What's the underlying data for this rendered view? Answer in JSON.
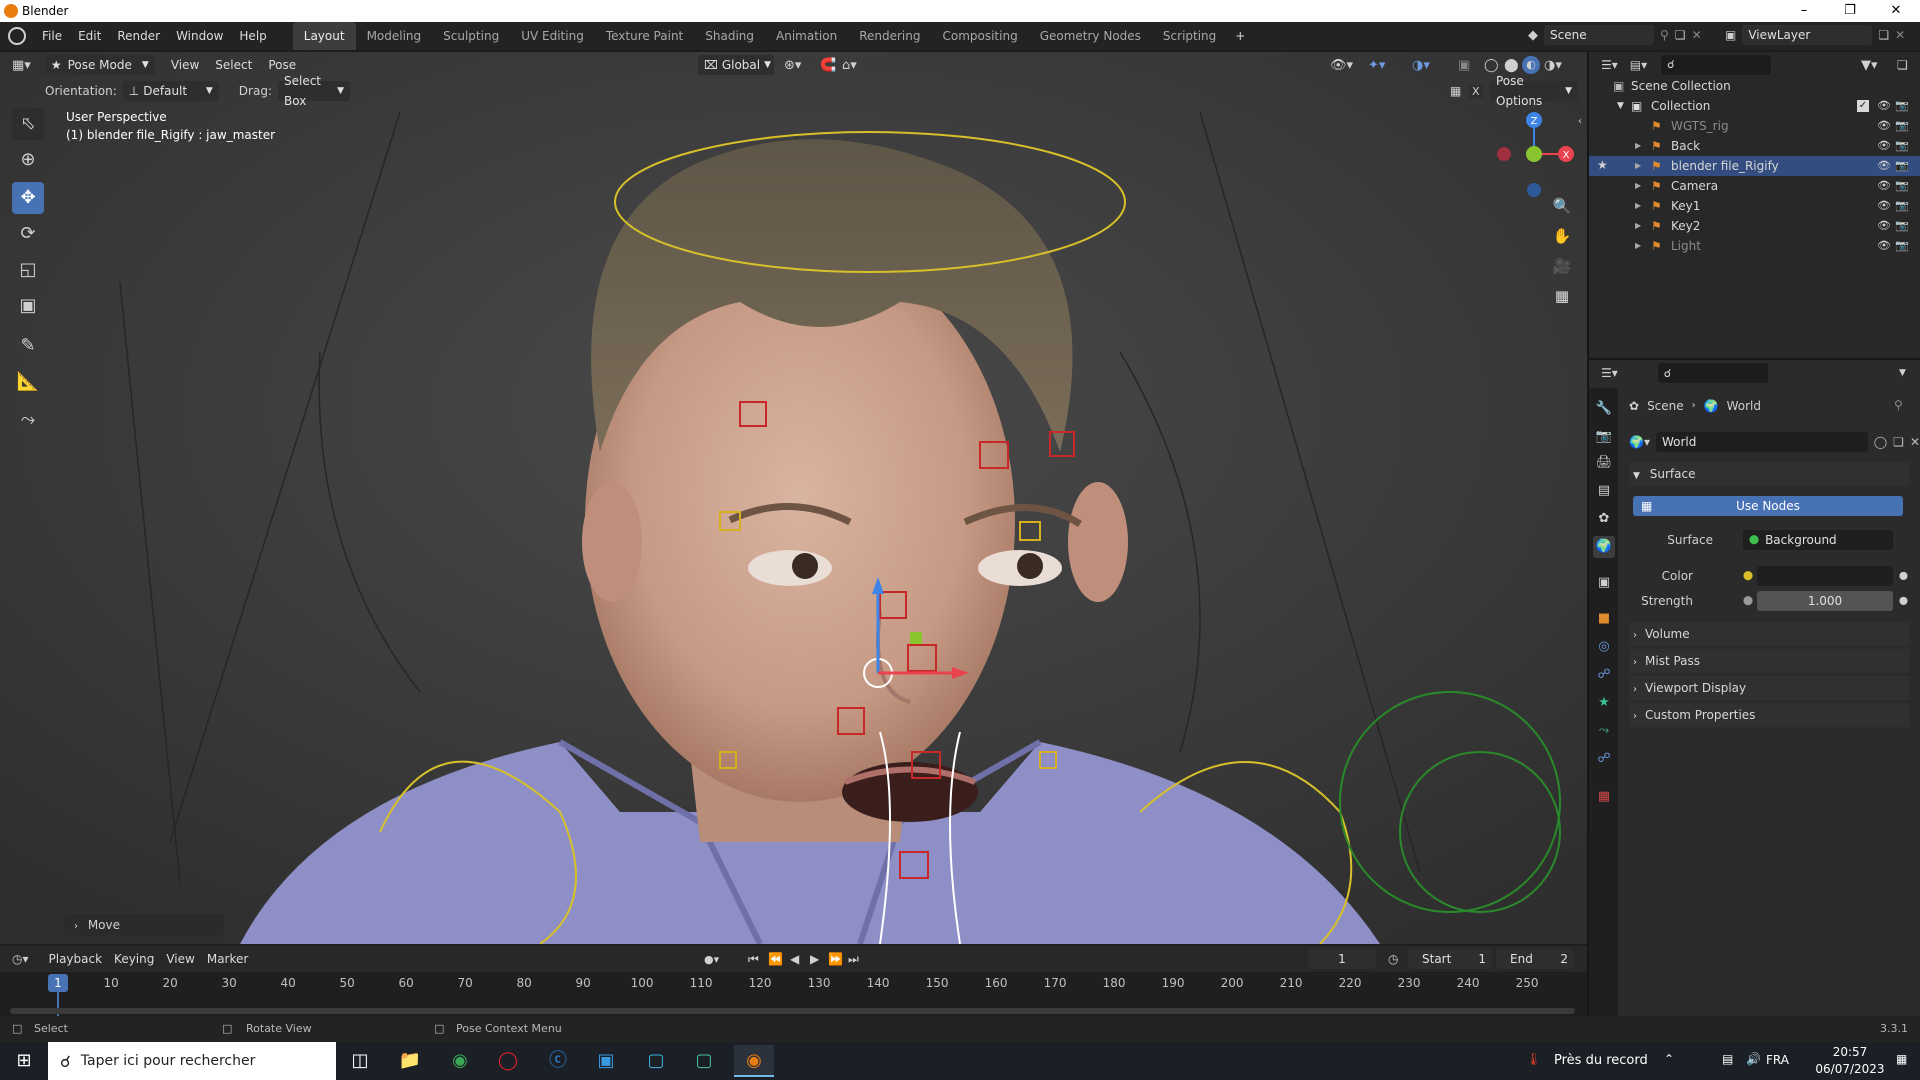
{
  "window": {
    "title": "Blender"
  },
  "menus": [
    "File",
    "Edit",
    "Render",
    "Window",
    "Help"
  ],
  "workspaces": [
    "Layout",
    "Modeling",
    "Sculpting",
    "UV Editing",
    "Texture Paint",
    "Shading",
    "Animation",
    "Rendering",
    "Compositing",
    "Geometry Nodes",
    "Scripting"
  ],
  "workspace_add": "+",
  "scene": {
    "name": "Scene",
    "view_layer": "ViewLayer"
  },
  "viewport": {
    "mode": "Pose Mode",
    "header_menus": [
      "View",
      "Select",
      "Pose"
    ],
    "transform_orientation": "Global",
    "orientation_label": "Orientation:",
    "orientation_value": "Default",
    "drag_label": "Drag:",
    "drag_value": "Select Box",
    "pose_options": "Pose Options",
    "overlay_title": "User Perspective",
    "overlay_object": "(1) blender file_Rigify : jaw_master",
    "last_op": "Move",
    "gizmo_labels": {
      "z": "Z",
      "x": "X"
    }
  },
  "outliner": {
    "root": "Scene Collection",
    "collection": "Collection",
    "items": [
      {
        "name": "WGTS_rig",
        "dim": true
      },
      {
        "name": "Back",
        "dim": false
      },
      {
        "name": "blender file_Rigify",
        "dim": false,
        "selected": true
      },
      {
        "name": "Camera",
        "dim": false
      },
      {
        "name": "Key1",
        "dim": false
      },
      {
        "name": "Key2",
        "dim": false
      },
      {
        "name": "Light",
        "dim": true
      }
    ]
  },
  "properties": {
    "breadcrumb": [
      "Scene",
      "World"
    ],
    "datablock": "World",
    "surface_panel": "Surface",
    "use_nodes": "Use Nodes",
    "surface_label": "Surface",
    "surface_value": "Background",
    "color_label": "Color",
    "strength_label": "Strength",
    "strength_value": "1.000",
    "panels": [
      "Volume",
      "Mist Pass",
      "Viewport Display",
      "Custom Properties"
    ]
  },
  "timeline": {
    "menus": [
      "Playback",
      "Keying",
      "View",
      "Marker"
    ],
    "current_frame": "1",
    "start_label": "Start",
    "start_value": "1",
    "end_label": "End",
    "end_value": "2",
    "ticks": [
      "1",
      "10",
      "20",
      "30",
      "40",
      "50",
      "60",
      "70",
      "80",
      "90",
      "100",
      "110",
      "120",
      "130",
      "140",
      "150",
      "160",
      "170",
      "180",
      "190",
      "200",
      "210",
      "220",
      "230",
      "240",
      "250"
    ]
  },
  "statusbar": {
    "select": "Select",
    "rotate": "Rotate View",
    "context": "Pose Context Menu",
    "version": "3.3.1"
  },
  "taskbar": {
    "search_placeholder": "Taper ici pour rechercher",
    "weather": "Près du record",
    "lang": "FRA",
    "time": "20:57",
    "date": "06/07/2023"
  },
  "colors": {
    "accent": "#4772b3",
    "selected_row": "#334d80",
    "x_axis": "#e8434f",
    "y_axis": "#8ac530",
    "z_axis": "#3d84e6"
  }
}
